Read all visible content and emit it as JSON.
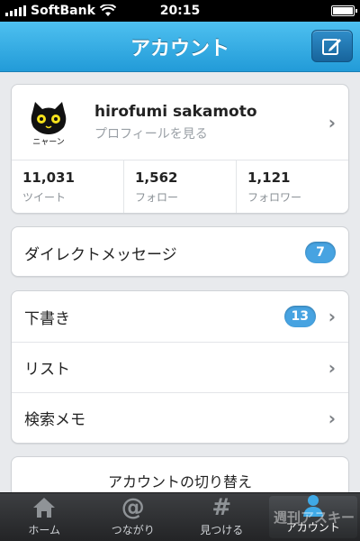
{
  "status_bar": {
    "carrier": "SoftBank",
    "time": "20:15"
  },
  "nav": {
    "title": "アカウント",
    "compose_icon": "compose-icon"
  },
  "profile": {
    "name": "hirofumi sakamoto",
    "subtitle": "プロフィールを見る",
    "avatar_caption": "ニャーン",
    "stats": [
      {
        "value": "11,031",
        "label": "ツイート"
      },
      {
        "value": "1,562",
        "label": "フォロー"
      },
      {
        "value": "1,121",
        "label": "フォロワー"
      }
    ]
  },
  "direct_messages": {
    "label": "ダイレクトメッセージ",
    "count": "7"
  },
  "menu": [
    {
      "label": "下書き",
      "badge": "13"
    },
    {
      "label": "リスト"
    },
    {
      "label": "検索メモ"
    }
  ],
  "switch_account": {
    "label": "アカウントの切り替え"
  },
  "tabs": [
    {
      "label": "ホーム",
      "icon": "house-icon"
    },
    {
      "label": "つながり",
      "icon": "@"
    },
    {
      "label": "見つける",
      "icon": "#"
    },
    {
      "label": "アカウント",
      "icon": "person-icon"
    }
  ],
  "watermark": "週刊アスキー",
  "colors": {
    "nav_top": "#4ec0f0",
    "nav_bottom": "#229bd8",
    "badge": "#47a3e1",
    "tabbar": "#2a2b2d"
  }
}
